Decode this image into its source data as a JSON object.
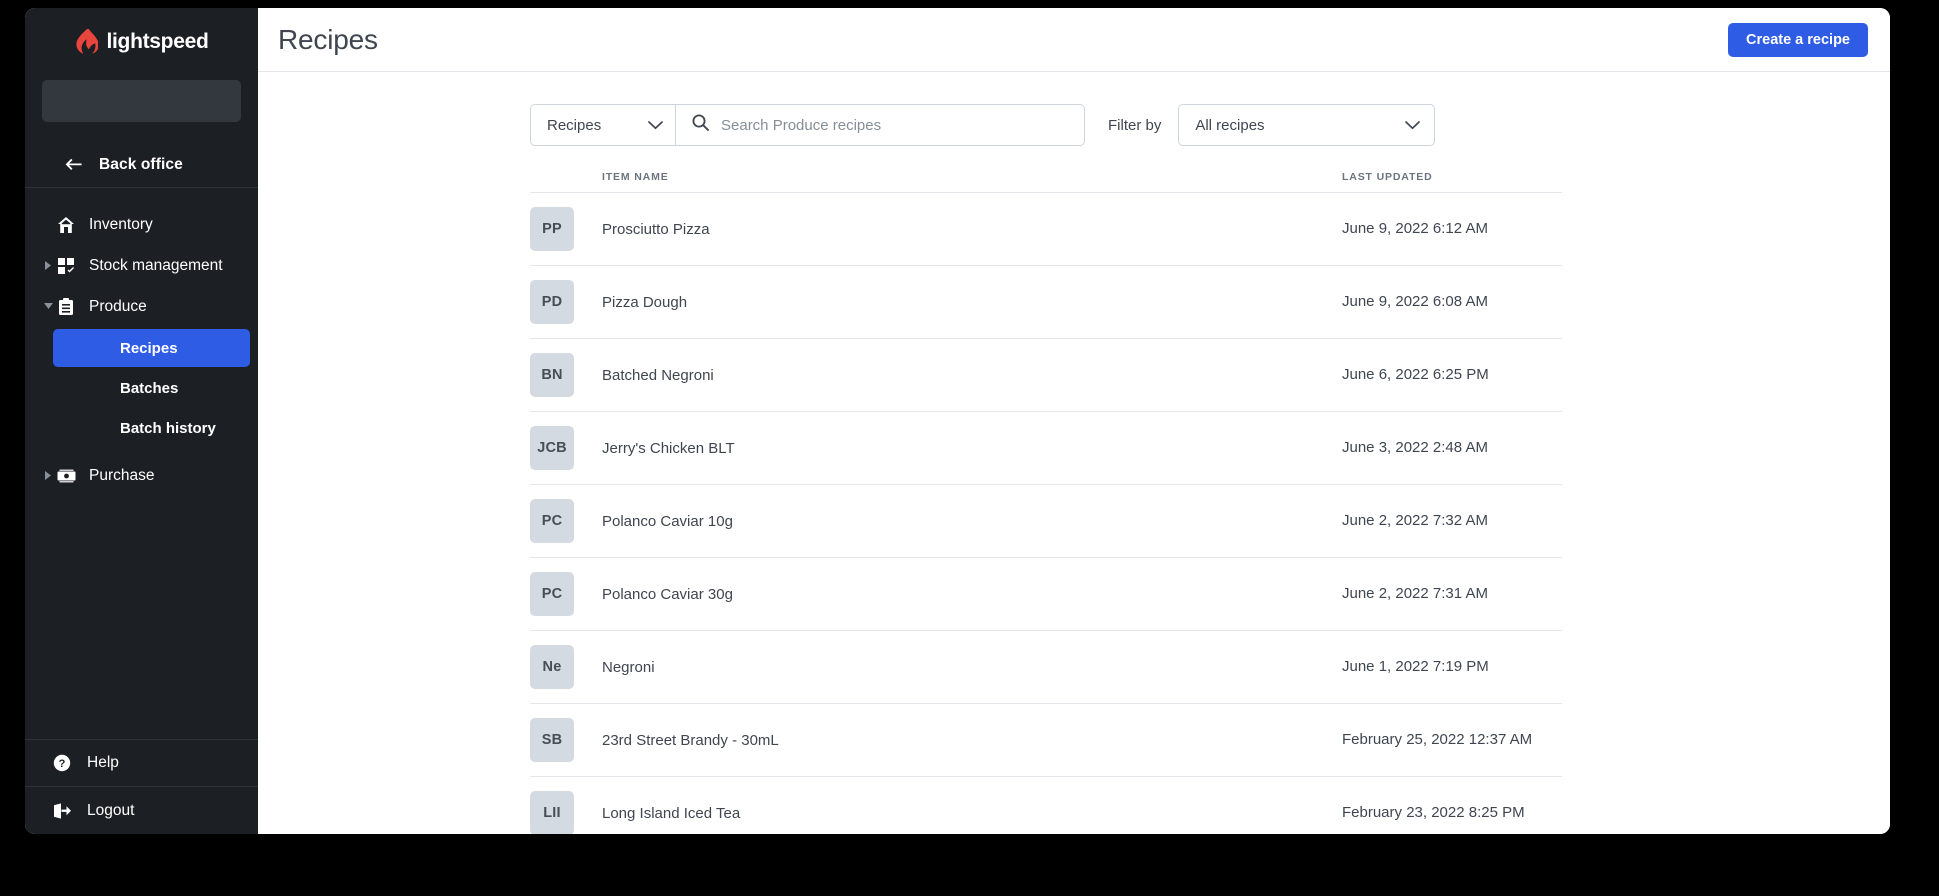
{
  "brand": {
    "name": "lightspeed",
    "logo_icon": "lightspeed-flame-icon",
    "accent": "#e8453c"
  },
  "theme": {
    "sidebar_bg": "#1c1f24",
    "accent_blue": "#2f5ce5",
    "text_dark": "#3f4650",
    "badge_bg": "#d4dae1"
  },
  "sidebar": {
    "search_placeholder": "",
    "back_office": {
      "label": "Back office",
      "icon": "arrow-left-icon"
    },
    "items": [
      {
        "label": "Inventory",
        "icon": "home-icon",
        "caret": "none",
        "active": false
      },
      {
        "label": "Stock management",
        "icon": "stock-grid-icon",
        "caret": "collapsed",
        "active": false
      },
      {
        "label": "Produce",
        "icon": "clipboard-icon",
        "caret": "expanded",
        "active": false
      }
    ],
    "produce_children": [
      {
        "label": "Recipes",
        "active": true
      },
      {
        "label": "Batches",
        "active": false
      },
      {
        "label": "Batch history",
        "active": false
      }
    ],
    "items_after": [
      {
        "label": "Purchase",
        "icon": "banknote-icon",
        "caret": "collapsed",
        "active": false
      }
    ],
    "bottom": [
      {
        "label": "Help",
        "icon": "help-circle-icon"
      },
      {
        "label": "Logout",
        "icon": "logout-icon"
      }
    ]
  },
  "header": {
    "title": "Recipes",
    "create_button": "Create a recipe"
  },
  "toolbar": {
    "scope_select_value": "Recipes",
    "scope_chevron_icon": "chevron-down-icon",
    "search_icon": "search-icon",
    "search_value": "",
    "search_placeholder": "Search Produce recipes",
    "filter_label": "Filter by",
    "filter_value": "All recipes",
    "filter_chevron_icon": "chevron-down-icon"
  },
  "table": {
    "columns": [
      "",
      "ITEM NAME",
      "LAST UPDATED"
    ],
    "rows": [
      {
        "initials": "PP",
        "name": "Prosciutto Pizza",
        "updated": "June 9, 2022 6:12 AM"
      },
      {
        "initials": "PD",
        "name": "Pizza Dough",
        "updated": "June 9, 2022 6:08 AM"
      },
      {
        "initials": "BN",
        "name": "Batched Negroni",
        "updated": "June 6, 2022 6:25 PM"
      },
      {
        "initials": "JCB",
        "name": "Jerry's Chicken BLT",
        "updated": "June 3, 2022 2:48 AM"
      },
      {
        "initials": "PC",
        "name": "Polanco Caviar 10g",
        "updated": "June 2, 2022 7:32 AM"
      },
      {
        "initials": "PC",
        "name": "Polanco Caviar 30g",
        "updated": "June 2, 2022 7:31 AM"
      },
      {
        "initials": "Ne",
        "name": "Negroni",
        "updated": "June 1, 2022 7:19 PM"
      },
      {
        "initials": "SB",
        "name": "23rd Street Brandy - 30mL",
        "updated": "February 25, 2022 12:37 AM"
      },
      {
        "initials": "LII",
        "name": "Long Island Iced Tea",
        "updated": "February 23, 2022 8:25 PM"
      }
    ]
  }
}
